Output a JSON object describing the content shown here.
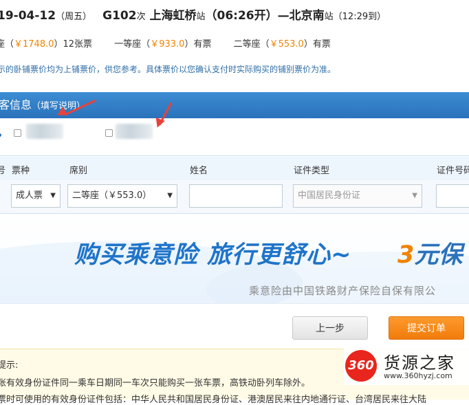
{
  "train": {
    "date": "19-04-12",
    "weekday": "（周五）",
    "number": "G102",
    "number_suffix": "次",
    "from": "上海虹桥",
    "from_suffix": "站",
    "depart": "（06:26开）",
    "separator": "—",
    "to": "北京南",
    "to_suffix": "站",
    "arrive": "（12:29到）"
  },
  "seats": [
    {
      "prefix": "座（",
      "price": "￥1748.0",
      "suffix": "）12张票"
    },
    {
      "prefix": "一等座（",
      "price": "￥933.0",
      "suffix": "）有票"
    },
    {
      "prefix": "二等座（",
      "price": "￥553.0",
      "suffix": "）有票"
    }
  ],
  "note": "示的卧铺票价均为上铺票价，供您参考。具体票价以您确认支付时实际购买的铺别票价为准。",
  "passenger_panel": {
    "title": "客信息",
    "hint": "（填写说明）"
  },
  "columns": {
    "col0": "号",
    "ticket_type": "票种",
    "seat_class": "席别",
    "name": "姓名",
    "id_type": "证件类型",
    "id_number": "证件号码"
  },
  "row": {
    "ticket_type": "成人票",
    "seat_class": "二等座（￥553.0）",
    "name": "",
    "id_type": "中国居民身份证",
    "id_number": ""
  },
  "banner": {
    "slogan": "购买乘意险  旅行更舒心~",
    "promo_num": "3",
    "promo_text": "元保",
    "insurer": "乘意险由中国铁路财产保险自保有限公"
  },
  "buttons": {
    "prev": "上一步",
    "submit": "提交订单"
  },
  "tips": {
    "title": "提示:",
    "line1": "张有效身份证件同一乘车日期同一车次只能购买一张车票，高铁动卧列车除外。",
    "line2": "票时可使用的有效身份证件包括：中华人民共和国居民身份证、港澳居民来往内地通行证、台湾居民来往大陆"
  },
  "watermark": {
    "logo": "360",
    "name": "货源之家",
    "url": "www.360hyzj.com"
  },
  "colors": {
    "header_blue": "#2a72bb",
    "price_orange": "#f08300",
    "submit_orange": "#f07c0a",
    "arrow_red": "#e8423b"
  }
}
